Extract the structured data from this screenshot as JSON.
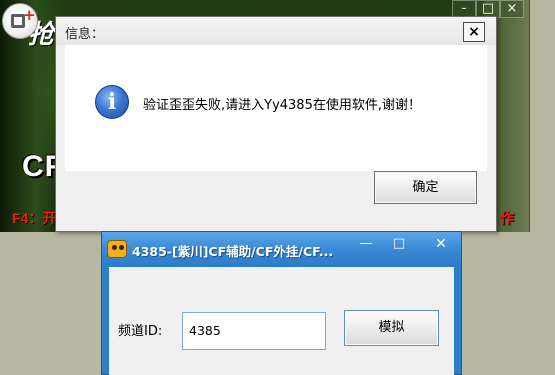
{
  "background_window": {
    "title_fragment": "CF",
    "f4_fragment": "F4：开",
    "right_fragment": "作",
    "logo_fragment": "抢",
    "controls": [
      "-",
      "□",
      "×"
    ]
  },
  "message_box": {
    "title": "信息：",
    "close_glyph": "×",
    "icon": "info-icon",
    "icon_glyph": "i",
    "message": "验证歪歪失败,请进入Yy4385在使用软件,谢谢！",
    "ok_label": "确定"
  },
  "tool_window": {
    "title": "4385-[紫川]CF辅助/CF外挂/CF...",
    "min_glyph": "—",
    "max_glyph": "□",
    "close_glyph": "✕",
    "channel_label": "频道ID:",
    "channel_value": "4385",
    "simulate_label": "模拟"
  },
  "colors": {
    "tool_titlebar": "#3a8ad6",
    "message_bg": "#ffffff",
    "dialog_bg": "#f0f0f0",
    "warning_text": "#f21f10"
  }
}
